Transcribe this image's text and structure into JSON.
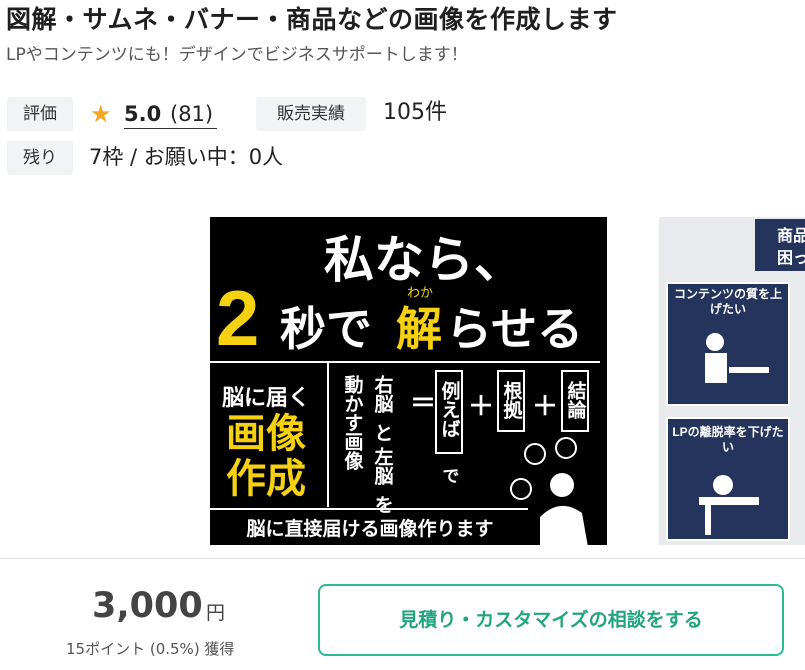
{
  "header": {
    "title": "図解・サムネ・バナー・商品などの画像を作成します",
    "subtitle": "LPやコンテンツにも！デザインでビジネスサポートします！"
  },
  "stats": {
    "rating_label": "評価",
    "rating_score": "5.0",
    "rating_count": "(81)",
    "sales_label": "販売実績",
    "sales_count": "105件",
    "slots_label": "残り",
    "slots_value": "7枠 / お願い中：0人"
  },
  "gallery": {
    "image1": {
      "line1": "私なら、",
      "big_number": "2",
      "line2a": "秒で",
      "ruby": "わか",
      "line2b": "解",
      "line2c": "らせる",
      "left_1": "脳に届く",
      "left_2": "画像",
      "left_3": "作成",
      "col_a": "動かす画像",
      "col_b1": "右脳",
      "col_b2": "と",
      "col_b3": "左脳",
      "col_b4": "を",
      "equals": "＝",
      "box1": "例えば",
      "box1_sub": "で",
      "plus": "＋",
      "box2": "根拠",
      "box3": "結論",
      "footer": "脳に直接届ける画像作ります"
    },
    "image2": {
      "top_label_1": "商品",
      "top_label_2": "困っ",
      "card1": "コンテンツの質を上げたい",
      "card2": "LPの離脱率を下げたい"
    }
  },
  "purchase": {
    "price": "3,000",
    "currency": "円",
    "points": "15ポイント (0.5%) 獲得",
    "consult_button": "見積り・カスタマイズの相談をする"
  },
  "colors": {
    "accent": "#2eb893",
    "star": "#f5a623",
    "highlight_yellow": "#f5d10f",
    "navy": "#24345c"
  },
  "icons": {
    "star": "star-icon",
    "lightbulb": "lightbulb-icon",
    "person": "person-icon"
  }
}
